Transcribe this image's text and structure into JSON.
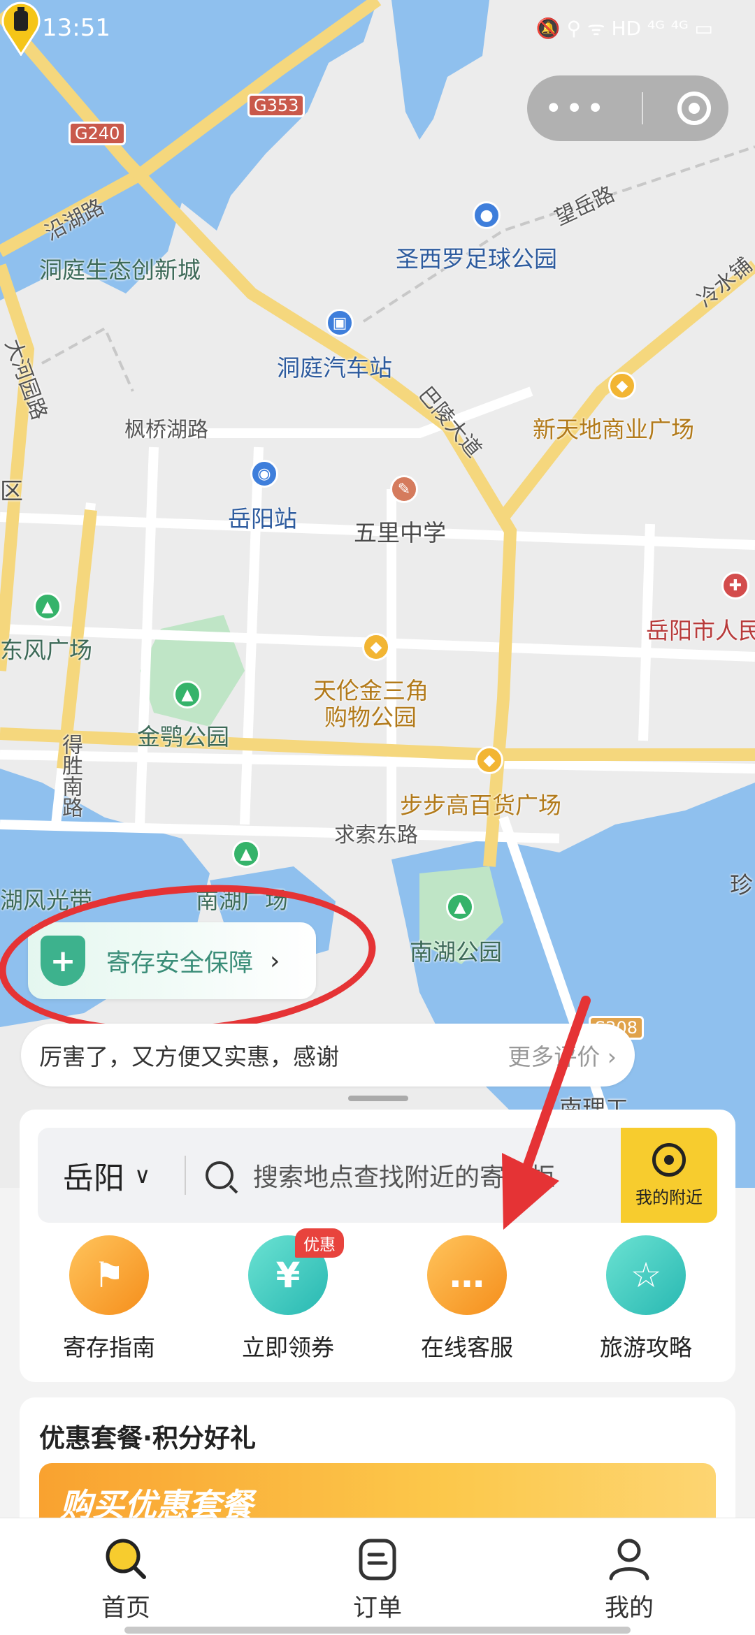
{
  "status_bar": {
    "time": "13:51",
    "icons": "🔕 ⚲ ᯤ HD ⁴ᴳ ⁴ᴳ ▭"
  },
  "map": {
    "roads": [
      "沿湖路",
      "望岳路",
      "冷水铺",
      "大河园路",
      "枫桥湖路",
      "巴陵大道",
      "得胜南路",
      "求索东路"
    ],
    "highway_shields": [
      "G240",
      "G353",
      "S208"
    ],
    "places": {
      "dongting_eco": "洞庭生态创新城",
      "stadium": "圣西罗足球公园",
      "bus_station": "洞庭汽车站",
      "xintiandi": "新天地商业广场",
      "station": "岳阳站",
      "school": "五里中学",
      "hospital": "岳阳市人民",
      "dongfeng": "东风广场",
      "tianlun_1": "天伦金三角",
      "tianlun_2": "购物公园",
      "jine_park": "金鹗公园",
      "bubugao": "步步高百货广场",
      "lake_scenery": "湖风光带",
      "square": "南湖广场",
      "nanhu_park": "南湖公园",
      "zhen": "珍",
      "qu": "区",
      "ligong": "南理工"
    }
  },
  "capsule": {
    "more_icon": "more-dots-icon",
    "close_icon": "target-icon"
  },
  "security": {
    "label": "寄存安全保障",
    "chevron": "›"
  },
  "review": {
    "text": "厉害了，又方便又实惠，感谢",
    "more": "更多评价 ›"
  },
  "search": {
    "city": "岳阳",
    "caret": "∨",
    "placeholder": "搜索地点查找附近的寄存柜",
    "nearby_label": "我的附近"
  },
  "quick_actions": [
    {
      "label": "寄存指南",
      "icon": "signpost-icon",
      "glyph": "⚑"
    },
    {
      "label": "立即领券",
      "icon": "coupon-icon",
      "glyph": "¥",
      "badge": "优惠"
    },
    {
      "label": "在线客服",
      "icon": "chat-icon",
      "glyph": "…"
    },
    {
      "label": "旅游攻略",
      "icon": "guide-book-icon",
      "glyph": "☆"
    }
  ],
  "promo": {
    "title": "优惠套餐·积分好礼",
    "banner_text": "购买优惠套餐"
  },
  "tabs": [
    {
      "label": "首页",
      "icon": "home-search-icon",
      "active": true
    },
    {
      "label": "订单",
      "icon": "order-icon",
      "active": false
    },
    {
      "label": "我的",
      "icon": "profile-icon",
      "active": false
    }
  ],
  "colors": {
    "accent": "#f7cc2e",
    "annotation": "#e53335",
    "security_green": "#3db28d"
  }
}
